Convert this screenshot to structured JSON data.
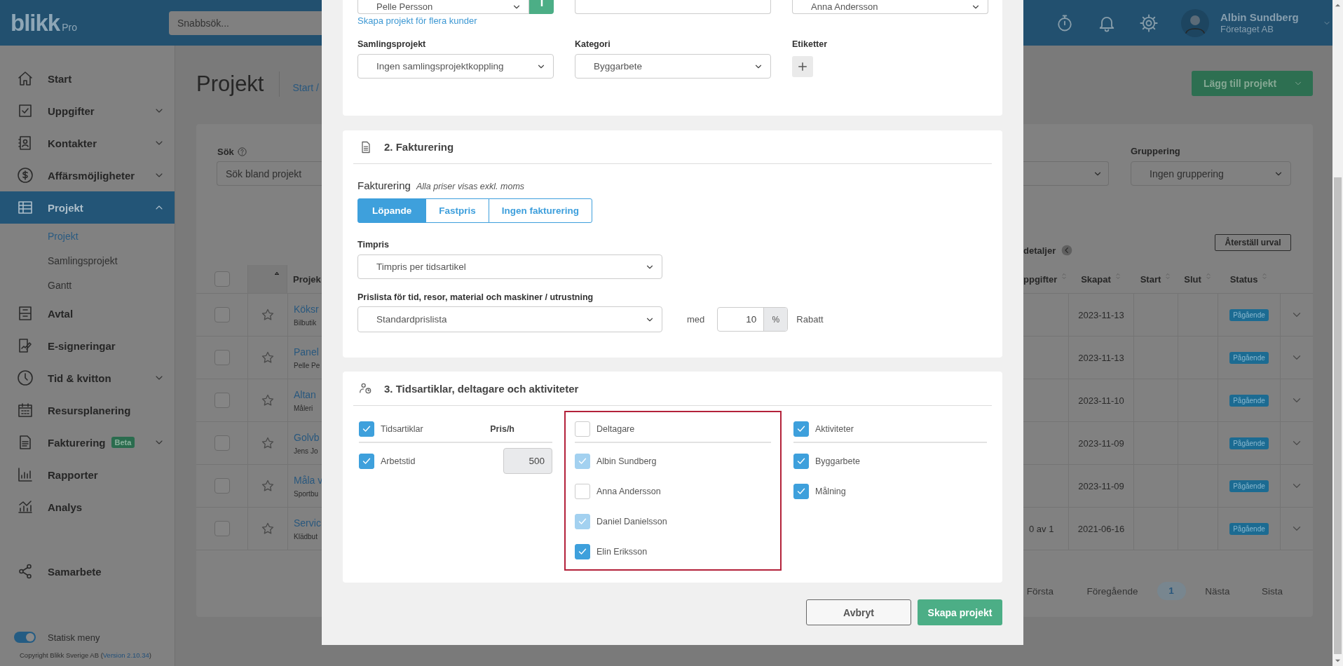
{
  "topbar": {
    "logo": "blikk",
    "logo_suffix": "Pro",
    "search_placeholder": "Snabbsök...",
    "user": {
      "name": "Albin Sundberg",
      "company": "Företaget AB"
    }
  },
  "sidebar": {
    "items": [
      {
        "label": "Start",
        "kind": "link",
        "selected": false
      },
      {
        "label": "Uppgifter",
        "kind": "group",
        "expanded": false,
        "selected": false
      },
      {
        "label": "Kontakter",
        "kind": "group",
        "expanded": false,
        "selected": false
      },
      {
        "label": "Affärsmöjligheter",
        "kind": "group",
        "expanded": false,
        "selected": false
      },
      {
        "label": "Projekt",
        "kind": "group",
        "expanded": true,
        "selected": true,
        "children": [
          {
            "label": "Projekt",
            "selected": true
          },
          {
            "label": "Samlingsprojekt",
            "selected": false
          },
          {
            "label": "Gantt",
            "selected": false
          }
        ]
      },
      {
        "label": "Avtal",
        "kind": "link",
        "selected": false
      },
      {
        "label": "E-signeringar",
        "kind": "link",
        "selected": false
      },
      {
        "label": "Tid & kvitton",
        "kind": "group",
        "expanded": false,
        "selected": false
      },
      {
        "label": "Resursplanering",
        "kind": "link",
        "selected": false
      },
      {
        "label": "Fakturering",
        "kind": "group",
        "expanded": false,
        "selected": false,
        "badge": "Beta"
      },
      {
        "label": "Rapporter",
        "kind": "link",
        "selected": false
      },
      {
        "label": "Analys",
        "kind": "link",
        "selected": false
      }
    ],
    "extra_items": [
      {
        "label": "Samarbete",
        "selected": false
      }
    ],
    "static_menu": {
      "label": "Statisk meny",
      "on": true
    },
    "copyright": {
      "text_before": "Copyright Blikk Sverige AB (",
      "version_link": "Version 2.10.34",
      "text_after": ")"
    }
  },
  "page": {
    "title": "Projekt",
    "breadcrumb": "Start /",
    "add_button": "Lägg till projekt",
    "filters": {
      "search_label": "Sök",
      "search_placeholder": "Sök bland projekt",
      "grouping_label": "Gruppering",
      "grouping_value": "Ingen gruppering"
    },
    "details_toggle": "detaljer",
    "reset_button": "Återställ urval",
    "table": {
      "select_all": false,
      "column_project": "Projek",
      "columns_right": [
        "ppgifter",
        "Skapat",
        "Start",
        "Slut",
        "Status"
      ],
      "rows": [
        {
          "selected": false,
          "favorite": false,
          "project": "Köksr",
          "customer": "Bilbutik",
          "created": "2023-11-13",
          "status": "Pågående"
        },
        {
          "selected": false,
          "favorite": false,
          "project": "Panel",
          "customer": "Pelle Pe",
          "created": "2023-11-13",
          "status": "Pågående"
        },
        {
          "selected": false,
          "favorite": false,
          "project": "Altan",
          "customer": "Måleri",
          "created": "2023-11-10",
          "status": "Pågående"
        },
        {
          "selected": false,
          "favorite": false,
          "project": "Golvb",
          "customer": "Jens Jo",
          "created": "2023-11-09",
          "status": "Pågående"
        },
        {
          "selected": false,
          "favorite": false,
          "project": "Måla v",
          "customer": "Sportbu",
          "created": "2023-11-09",
          "status": "Pågående"
        },
        {
          "selected": false,
          "favorite": false,
          "project": "Servic",
          "customer": "Klädbut",
          "tasks": "0 av 1",
          "created": "2021-06-16",
          "status": "Pågående"
        }
      ]
    },
    "pagination": [
      {
        "label": "Första",
        "selected": false
      },
      {
        "label": "Föregående",
        "selected": false
      },
      {
        "label": "1",
        "selected": true
      },
      {
        "label": "Nästa",
        "selected": false
      },
      {
        "label": "Sista",
        "selected": false
      }
    ]
  },
  "modal": {
    "section1": {
      "customer_value": "Pelle Persson",
      "field_3_value": "Anna Andersson",
      "multi_customer_link": "Skapa projekt för flera kunder",
      "collection_label": "Samlingsprojekt",
      "collection_value": "Ingen samlingsprojektkoppling",
      "category_label": "Kategori",
      "category_value": "Byggarbete",
      "tags_label": "Etiketter"
    },
    "billing": {
      "title": "2. Fakturering",
      "label": "Fakturering",
      "note": "Alla priser visas exkl. moms",
      "modes": [
        {
          "label": "Löpande",
          "selected": true
        },
        {
          "label": "Fastpris",
          "selected": false
        },
        {
          "label": "Ingen fakturering",
          "selected": false
        }
      ],
      "hourly_label": "Timpris",
      "hourly_value": "Timpris per tidsartikel",
      "pricelist_label": "Prislista för tid, resor, material och maskiner / utrustning",
      "pricelist_value": "Standardprislista",
      "with_label": "med",
      "discount_value": "10",
      "discount_unit": "%",
      "discount_label": "Rabatt"
    },
    "resources": {
      "title": "3. Tidsartiklar, deltagare och aktiviteter",
      "time_articles": {
        "header": {
          "label": "Tidsartiklar",
          "checked": true
        },
        "price_header": "Pris/h",
        "items": [
          {
            "label": "Arbetstid",
            "checked": true,
            "price": "500"
          }
        ]
      },
      "participants": {
        "header": {
          "label": "Deltagare",
          "checked": false
        },
        "items": [
          {
            "label": "Albin Sundberg",
            "checked": true,
            "disabled": true
          },
          {
            "label": "Anna Andersson",
            "checked": false,
            "disabled": false
          },
          {
            "label": "Daniel Danielsson",
            "checked": true,
            "disabled": true
          },
          {
            "label": "Elin Eriksson",
            "checked": true,
            "disabled": false
          }
        ]
      },
      "activities": {
        "header": {
          "label": "Aktiviteter",
          "checked": true
        },
        "items": [
          {
            "label": "Byggarbete",
            "checked": true
          },
          {
            "label": "Målning",
            "checked": true
          }
        ]
      }
    },
    "buttons": {
      "cancel": "Avbryt",
      "submit": "Skapa projekt"
    }
  }
}
